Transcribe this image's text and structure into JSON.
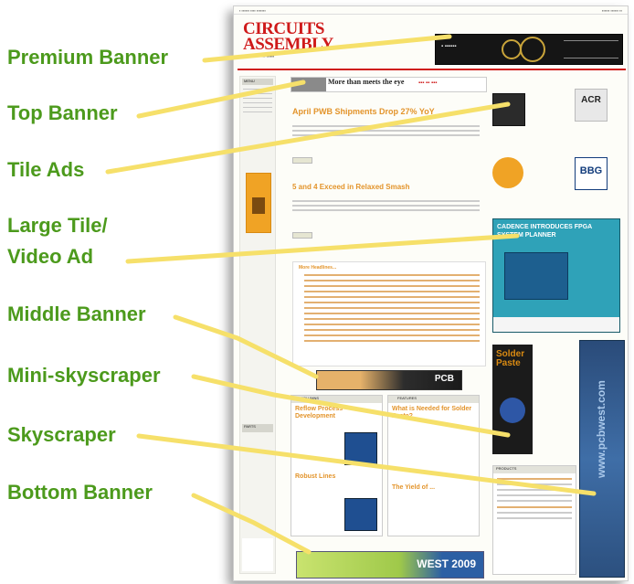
{
  "annotations": [
    {
      "text": "Premium Banner"
    },
    {
      "text": "Top Banner"
    },
    {
      "text": "Tile Ads"
    },
    {
      "text": "Large Tile/"
    },
    {
      "text": "Video Ad"
    },
    {
      "text": "Middle Banner"
    },
    {
      "text": "Mini-skyscraper"
    },
    {
      "text": "Skyscraper"
    },
    {
      "text": "Bottom Banner"
    }
  ],
  "site": {
    "logo_line1": "CIRCUITS",
    "logo_line2": "ASSEMBLY",
    "menu_label": "MENU",
    "parts_label": "PARTS",
    "top_banner_text": "More than meets the eye",
    "headline1": "April PWB Shipments Drop 27% YoY",
    "headline2": "5 and 4 Exceed in Relaxed Smash",
    "more_headlines": "More Headlines...",
    "middle_banner_text": "PCB",
    "columns_label": "COLUMNS",
    "features_label": "FEATURES",
    "column_headline1": "Reflow Process Development",
    "column_headline2": "Robust Lines",
    "feature_headline1": "What is Needed for Solder Paste?",
    "feature_headline2": "The Yield of ...",
    "products_label": "PRODUCTS",
    "large_tile_caption": "CADENCE INTRODUCES FPGA SYSTEM PLANNER",
    "mini_skyscraper_text": "Solder Paste",
    "skyscraper_text": "www.pcbwest.com",
    "bottom_banner_text": "WEST 2009",
    "tile2_text": "ACR",
    "tile4_text": "BBG"
  },
  "colors": {
    "label_green": "#4c9a1c",
    "callout_yellow": "#f6e06a",
    "logo_red": "#cf1a1a",
    "headline_orange": "#e3942b"
  }
}
